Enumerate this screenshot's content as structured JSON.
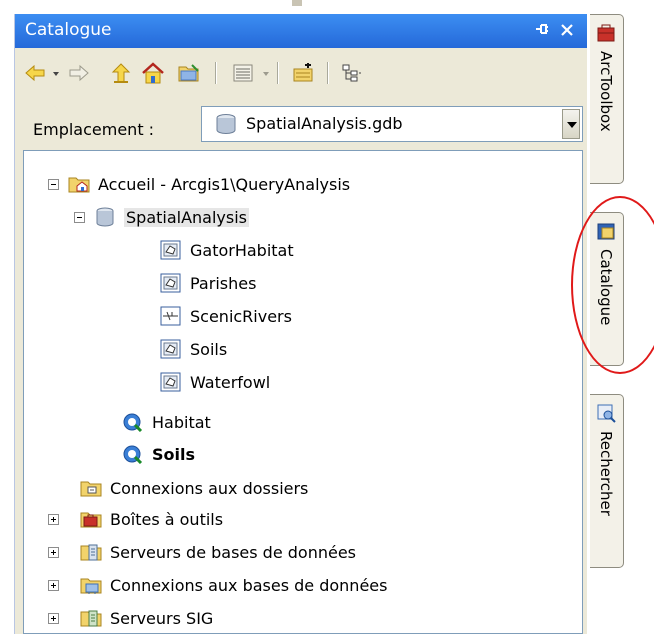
{
  "window": {
    "title": "Catalogue",
    "pin_icon": "pin-icon",
    "close_icon": "close-icon"
  },
  "toolbar": {
    "buttons": [
      "back-icon",
      "forward-icon",
      "up-one-level-icon",
      "home-icon",
      "connect-folder-icon",
      "views-icon",
      "new-item-icon",
      "tree-toggle-icon"
    ]
  },
  "location": {
    "label": "Emplacement :",
    "value": "SpatialAnalysis.gdb"
  },
  "tree": {
    "items": [
      {
        "label": "Accueil - Arcgis1\\QueryAnalysis",
        "icon": "home-folder-icon",
        "expander": "minus"
      },
      {
        "label": "SpatialAnalysis",
        "icon": "geodatabase-icon",
        "expander": "minus",
        "selected": true
      },
      {
        "label": "GatorHabitat",
        "icon": "polygon-feature-class-icon"
      },
      {
        "label": "Parishes",
        "icon": "polygon-feature-class-icon"
      },
      {
        "label": "ScenicRivers",
        "icon": "line-feature-class-icon"
      },
      {
        "label": "Soils",
        "icon": "polygon-feature-class-icon"
      },
      {
        "label": "Waterfowl",
        "icon": "polygon-feature-class-icon"
      },
      {
        "label": "Habitat",
        "icon": "layer-file-icon"
      },
      {
        "label": "Soils",
        "icon": "layer-file-icon",
        "bold": true
      },
      {
        "label": "Connexions aux dossiers",
        "icon": "folder-connections-icon"
      },
      {
        "label": "Boîtes à outils",
        "icon": "toolboxes-icon",
        "expander": "plus"
      },
      {
        "label": "Serveurs de bases de données",
        "icon": "database-servers-icon",
        "expander": "plus"
      },
      {
        "label": "Connexions aux bases de données",
        "icon": "database-connections-icon",
        "expander": "plus"
      },
      {
        "label": "Serveurs SIG",
        "icon": "gis-servers-icon",
        "expander": "plus"
      }
    ]
  },
  "dock_tabs": [
    {
      "label": "ArcToolbox",
      "icon": "arctoolbox-icon"
    },
    {
      "label": "Catalogue",
      "icon": "catalog-icon"
    },
    {
      "label": "Rechercher",
      "icon": "search-icon"
    }
  ],
  "colors": {
    "titlebar": "#2c74e3",
    "annotation": "#e01919"
  }
}
